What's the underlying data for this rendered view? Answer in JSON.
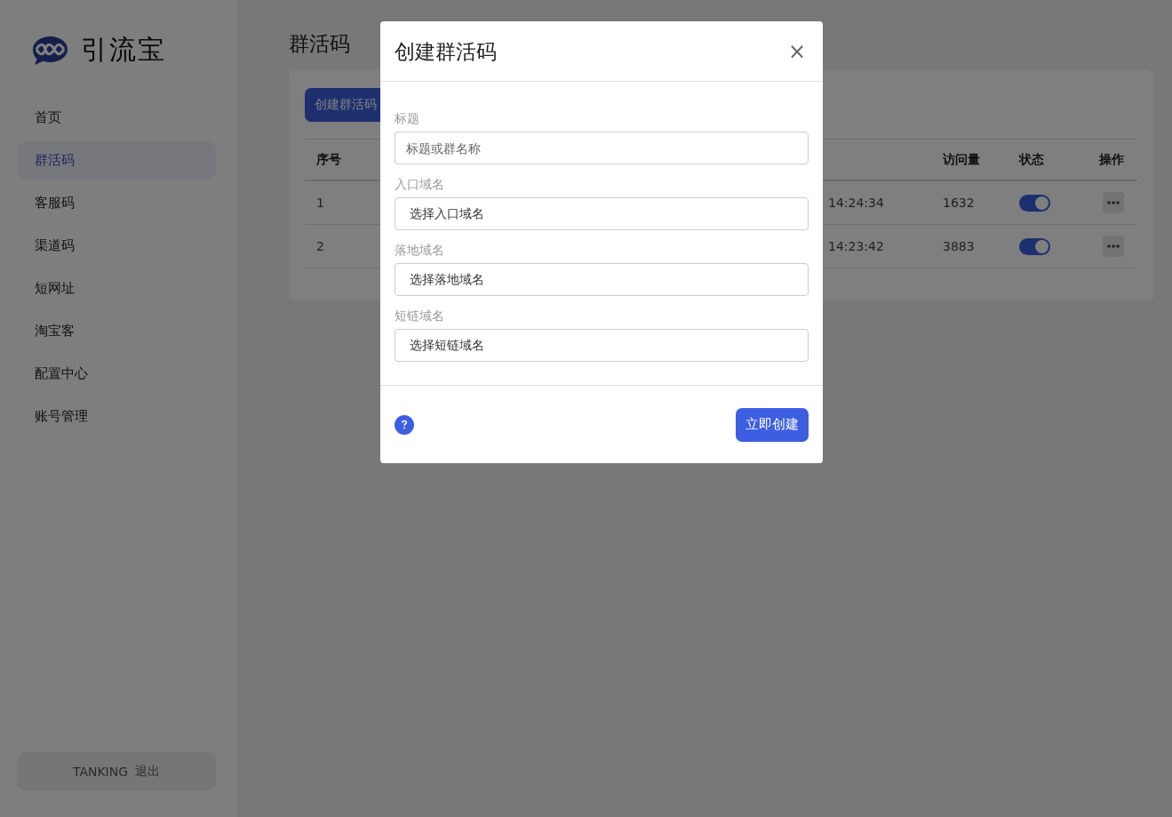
{
  "sidebar": {
    "logo": "引流宝",
    "items": [
      {
        "label": "首页",
        "selected": false
      },
      {
        "label": "群活码",
        "selected": true
      },
      {
        "label": "客服码",
        "selected": false
      },
      {
        "label": "渠道码",
        "selected": false
      },
      {
        "label": "短网址",
        "selected": false
      },
      {
        "label": "淘宝客",
        "selected": false
      },
      {
        "label": "配置中心",
        "selected": false
      },
      {
        "label": "账号管理",
        "selected": false
      }
    ],
    "user": {
      "name": "TANKING",
      "logout": "退出"
    }
  },
  "page": {
    "title": "群活码",
    "create_button": "创建群活码",
    "table": {
      "columns": [
        "序号",
        "访问量",
        "状态",
        "操作"
      ],
      "rows": [
        {
          "index": "1",
          "time": "14:24:34",
          "visits": "1632",
          "on": true
        },
        {
          "index": "2",
          "time": "14:23:42",
          "visits": "3883",
          "on": true
        }
      ]
    }
  },
  "modal": {
    "title": "创建群活码",
    "close": "×",
    "fields": [
      {
        "label": "标题",
        "kind": "text",
        "placeholder": "标题或群名称"
      },
      {
        "label": "入口域名",
        "kind": "select",
        "value": "选择入口域名"
      },
      {
        "label": "落地域名",
        "kind": "select",
        "value": "选择落地域名"
      },
      {
        "label": "短链域名",
        "kind": "select",
        "value": "选择短链域名"
      }
    ],
    "submit": "立即创建"
  }
}
